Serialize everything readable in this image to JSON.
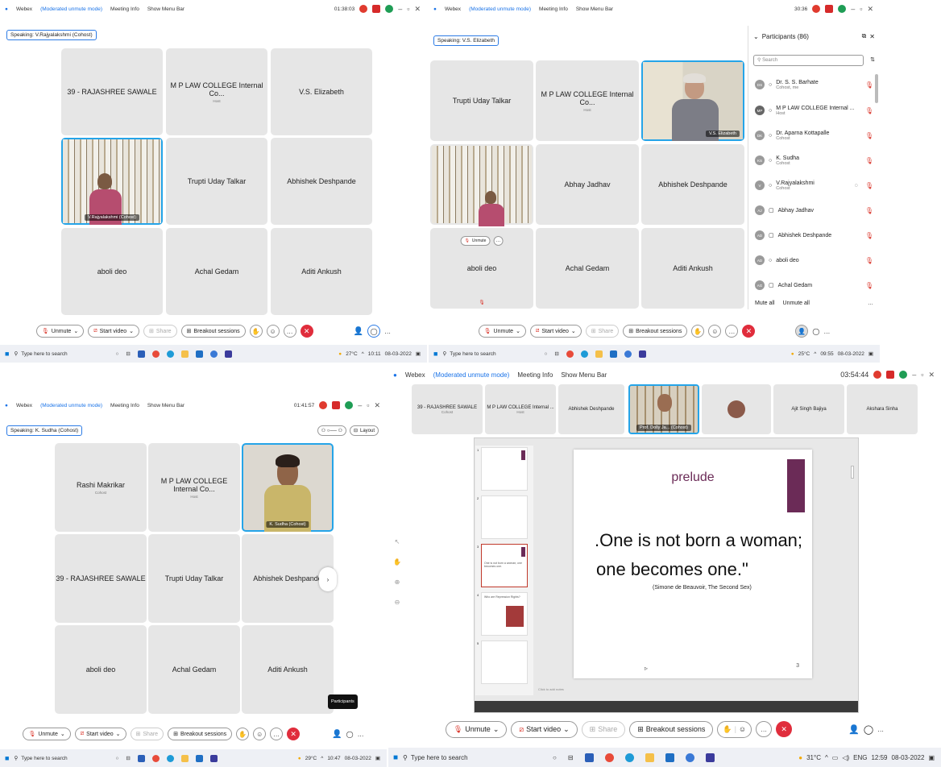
{
  "q1": {
    "app": "Webex",
    "mode": "(Moderated unmute mode)",
    "meeting_info": "Meeting Info",
    "menu": "Show Menu Bar",
    "time": "01:38:03",
    "speaking": "Speaking: V.Rajyalakshmi (Cohost)",
    "tiles": [
      {
        "name": "39 - RAJASHREE SAWALE",
        "role": ""
      },
      {
        "name": "M P LAW COLLEGE Internal Co...",
        "role": "Host"
      },
      {
        "name": "V.S. Elizabeth",
        "role": ""
      },
      {
        "name": "V.Rajyalakshmi (Cohost)",
        "role": ""
      },
      {
        "name": "Trupti Uday Talkar",
        "role": ""
      },
      {
        "name": "Abhishek Deshpande",
        "role": ""
      },
      {
        "name": "aboli deo",
        "role": ""
      },
      {
        "name": "Achal Gedam",
        "role": ""
      },
      {
        "name": "Aditi Ankush",
        "role": ""
      }
    ]
  },
  "q2": {
    "app": "Webex",
    "mode": "(Moderated unmute mode)",
    "meeting_info": "Meeting Info",
    "menu": "Show Menu Bar",
    "time": "30:36",
    "speaking": "Speaking: V.S. Elizabeth",
    "tiles": [
      {
        "name": "Trupti Uday Talkar",
        "role": ""
      },
      {
        "name": "M P LAW COLLEGE Internal Co...",
        "role": "Host"
      },
      {
        "name": "V.S. Elizabeth",
        "role": ""
      },
      {
        "name": "",
        "role": ""
      },
      {
        "name": "Abhay Jadhav",
        "role": ""
      },
      {
        "name": "Abhishek Deshpande",
        "role": ""
      },
      {
        "name": "aboli deo",
        "role": ""
      },
      {
        "name": "Achal Gedam",
        "role": ""
      },
      {
        "name": "Aditi Ankush",
        "role": ""
      }
    ],
    "unmute_chip": "Unmute",
    "participants": {
      "title": "Participants (86)",
      "search_placeholder": "Search",
      "rows": [
        {
          "initials": "DS",
          "name": "Dr. S. S. Barhate",
          "sub": "Cohost, me"
        },
        {
          "initials": "MP",
          "name": "M P LAW COLLEGE Internal ...",
          "sub": "Host"
        },
        {
          "initials": "DK",
          "name": "Dr. Aparna Kottapalle",
          "sub": "Cohost"
        },
        {
          "initials": "KS",
          "name": "K. Sudha",
          "sub": "Cohost"
        },
        {
          "initials": "V",
          "name": "V.Rajyalakshmi",
          "sub": "Cohost"
        },
        {
          "initials": "AJ",
          "name": "Abhay Jadhav",
          "sub": ""
        },
        {
          "initials": "AD",
          "name": "Abhishek Deshpande",
          "sub": ""
        },
        {
          "initials": "AD",
          "name": "aboli deo",
          "sub": ""
        },
        {
          "initials": "AG",
          "name": "Achal Gedam",
          "sub": ""
        }
      ],
      "mute_all": "Mute all",
      "unmute_all": "Unmute all"
    },
    "tray_time": "09:55",
    "tray_date": "08-03-2022",
    "temp": "25°C"
  },
  "q3": {
    "app": "Webex",
    "mode": "(Moderated unmute mode)",
    "meeting_info": "Meeting Info",
    "menu": "Show Menu Bar",
    "time": "01:41:57",
    "speaking": "Speaking: K. Sudha (Cohost)",
    "layout": "Layout",
    "tiles": [
      {
        "name": "Rashi Makrikar",
        "role": "Cohost"
      },
      {
        "name": "M P LAW COLLEGE Internal Co...",
        "role": "Host"
      },
      {
        "name": "K. Sudha (Cohost)",
        "role": ""
      },
      {
        "name": "39 - RAJASHREE SAWALE",
        "role": ""
      },
      {
        "name": "Trupti Uday Talkar",
        "role": ""
      },
      {
        "name": "Abhishek Deshpande",
        "role": ""
      },
      {
        "name": "aboli deo",
        "role": ""
      },
      {
        "name": "Achal Gedam",
        "role": ""
      },
      {
        "name": "Aditi Ankush",
        "role": ""
      }
    ],
    "tooltip": "Participants",
    "temp": "29°C",
    "tray_time": "10:47",
    "tray_date": "08-03-2022"
  },
  "q4": {
    "app": "Webex",
    "mode": "(Moderated unmute mode)",
    "meeting_info": "Meeting Info",
    "menu": "Show Menu Bar",
    "time": "03:54:44",
    "strip": [
      {
        "name": "39 - RAJASHREE SAWALE",
        "role": "Cohost"
      },
      {
        "name": "M P LAW COLLEGE Internal ...",
        "role": "Host"
      },
      {
        "name": "Abhishek Deshpande",
        "role": ""
      },
      {
        "name": "Prof. Dolly Ja... (Cohost)",
        "role": ""
      },
      {
        "name": "",
        "role": ""
      },
      {
        "name": "Ajit Singh Bajiya",
        "role": ""
      },
      {
        "name": "Akshara Sinha",
        "role": ""
      }
    ],
    "slide": {
      "title": "prelude",
      "quote1": ".One is not born a woman;",
      "quote2": "one becomes one.\"",
      "cite": "(Simone de Beauvoir, The Second Sex)",
      "page": "3"
    },
    "notes": "Click to add notes",
    "thumbs": [
      "1",
      "2",
      "3",
      "4",
      "5"
    ],
    "thumb3": "One is not born a woman; one becomes one.",
    "thumb4": "Who are Repression Rights?",
    "temp": "31°C",
    "lang": "ENG",
    "tray_time": "12:59",
    "tray_date": "08-03-2022"
  },
  "controls": {
    "unmute": "Unmute",
    "start_video": "Start video",
    "share": "Share",
    "breakout": "Breakout sessions"
  },
  "taskbar": {
    "search": "Type here to search",
    "temp1": "27°C",
    "time1": "10:11",
    "date1": "08-03-2022"
  }
}
